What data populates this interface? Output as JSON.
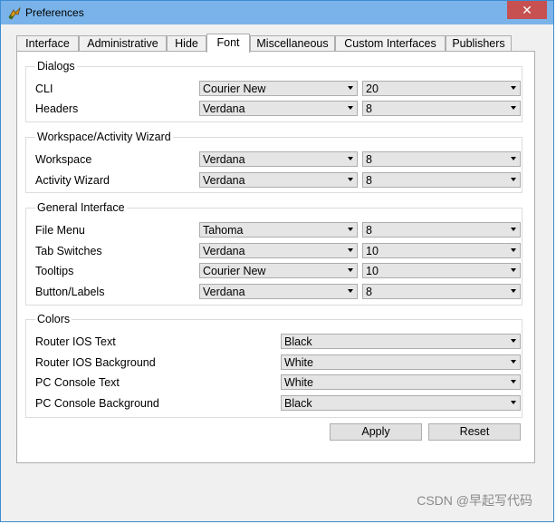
{
  "window": {
    "title": "Preferences",
    "close_glyph": "✕"
  },
  "tabs": [
    {
      "label": "Interface"
    },
    {
      "label": "Administrative"
    },
    {
      "label": "Hide"
    },
    {
      "label": "Font",
      "active": true
    },
    {
      "label": "Miscellaneous"
    },
    {
      "label": "Custom Interfaces"
    },
    {
      "label": "Publishers"
    }
  ],
  "groups": {
    "dialogs": {
      "title": "Dialogs",
      "rows": [
        {
          "label": "CLI",
          "font": "Courier New",
          "size": "20"
        },
        {
          "label": "Headers",
          "font": "Verdana",
          "size": "8"
        }
      ]
    },
    "workspace": {
      "title": "Workspace/Activity Wizard",
      "rows": [
        {
          "label": "Workspace",
          "font": "Verdana",
          "size": "8"
        },
        {
          "label": "Activity Wizard",
          "font": "Verdana",
          "size": "8"
        }
      ]
    },
    "general": {
      "title": "General Interface",
      "rows": [
        {
          "label": "File Menu",
          "font": "Tahoma",
          "size": "8"
        },
        {
          "label": "Tab Switches",
          "font": "Verdana",
          "size": "10"
        },
        {
          "label": "Tooltips",
          "font": "Courier New",
          "size": "10"
        },
        {
          "label": "Button/Labels",
          "font": "Verdana",
          "size": "8"
        }
      ]
    },
    "colors": {
      "title": "Colors",
      "rows": [
        {
          "label": "Router IOS Text",
          "value": "Black"
        },
        {
          "label": "Router IOS Background",
          "value": "White"
        },
        {
          "label": "PC Console Text",
          "value": "White"
        },
        {
          "label": "PC Console Background",
          "value": "Black"
        }
      ]
    }
  },
  "buttons": {
    "apply": "Apply",
    "reset": "Reset"
  },
  "watermark": "CSDN @早起写代码",
  "icons": {
    "app": "packet-tracer-icon",
    "close": "close-icon",
    "dropdown": "chevron-down-icon"
  },
  "colors": {
    "titlebar": "#7ab3e9",
    "close": "#c75050",
    "combo_bg": "#e5e5e5"
  }
}
